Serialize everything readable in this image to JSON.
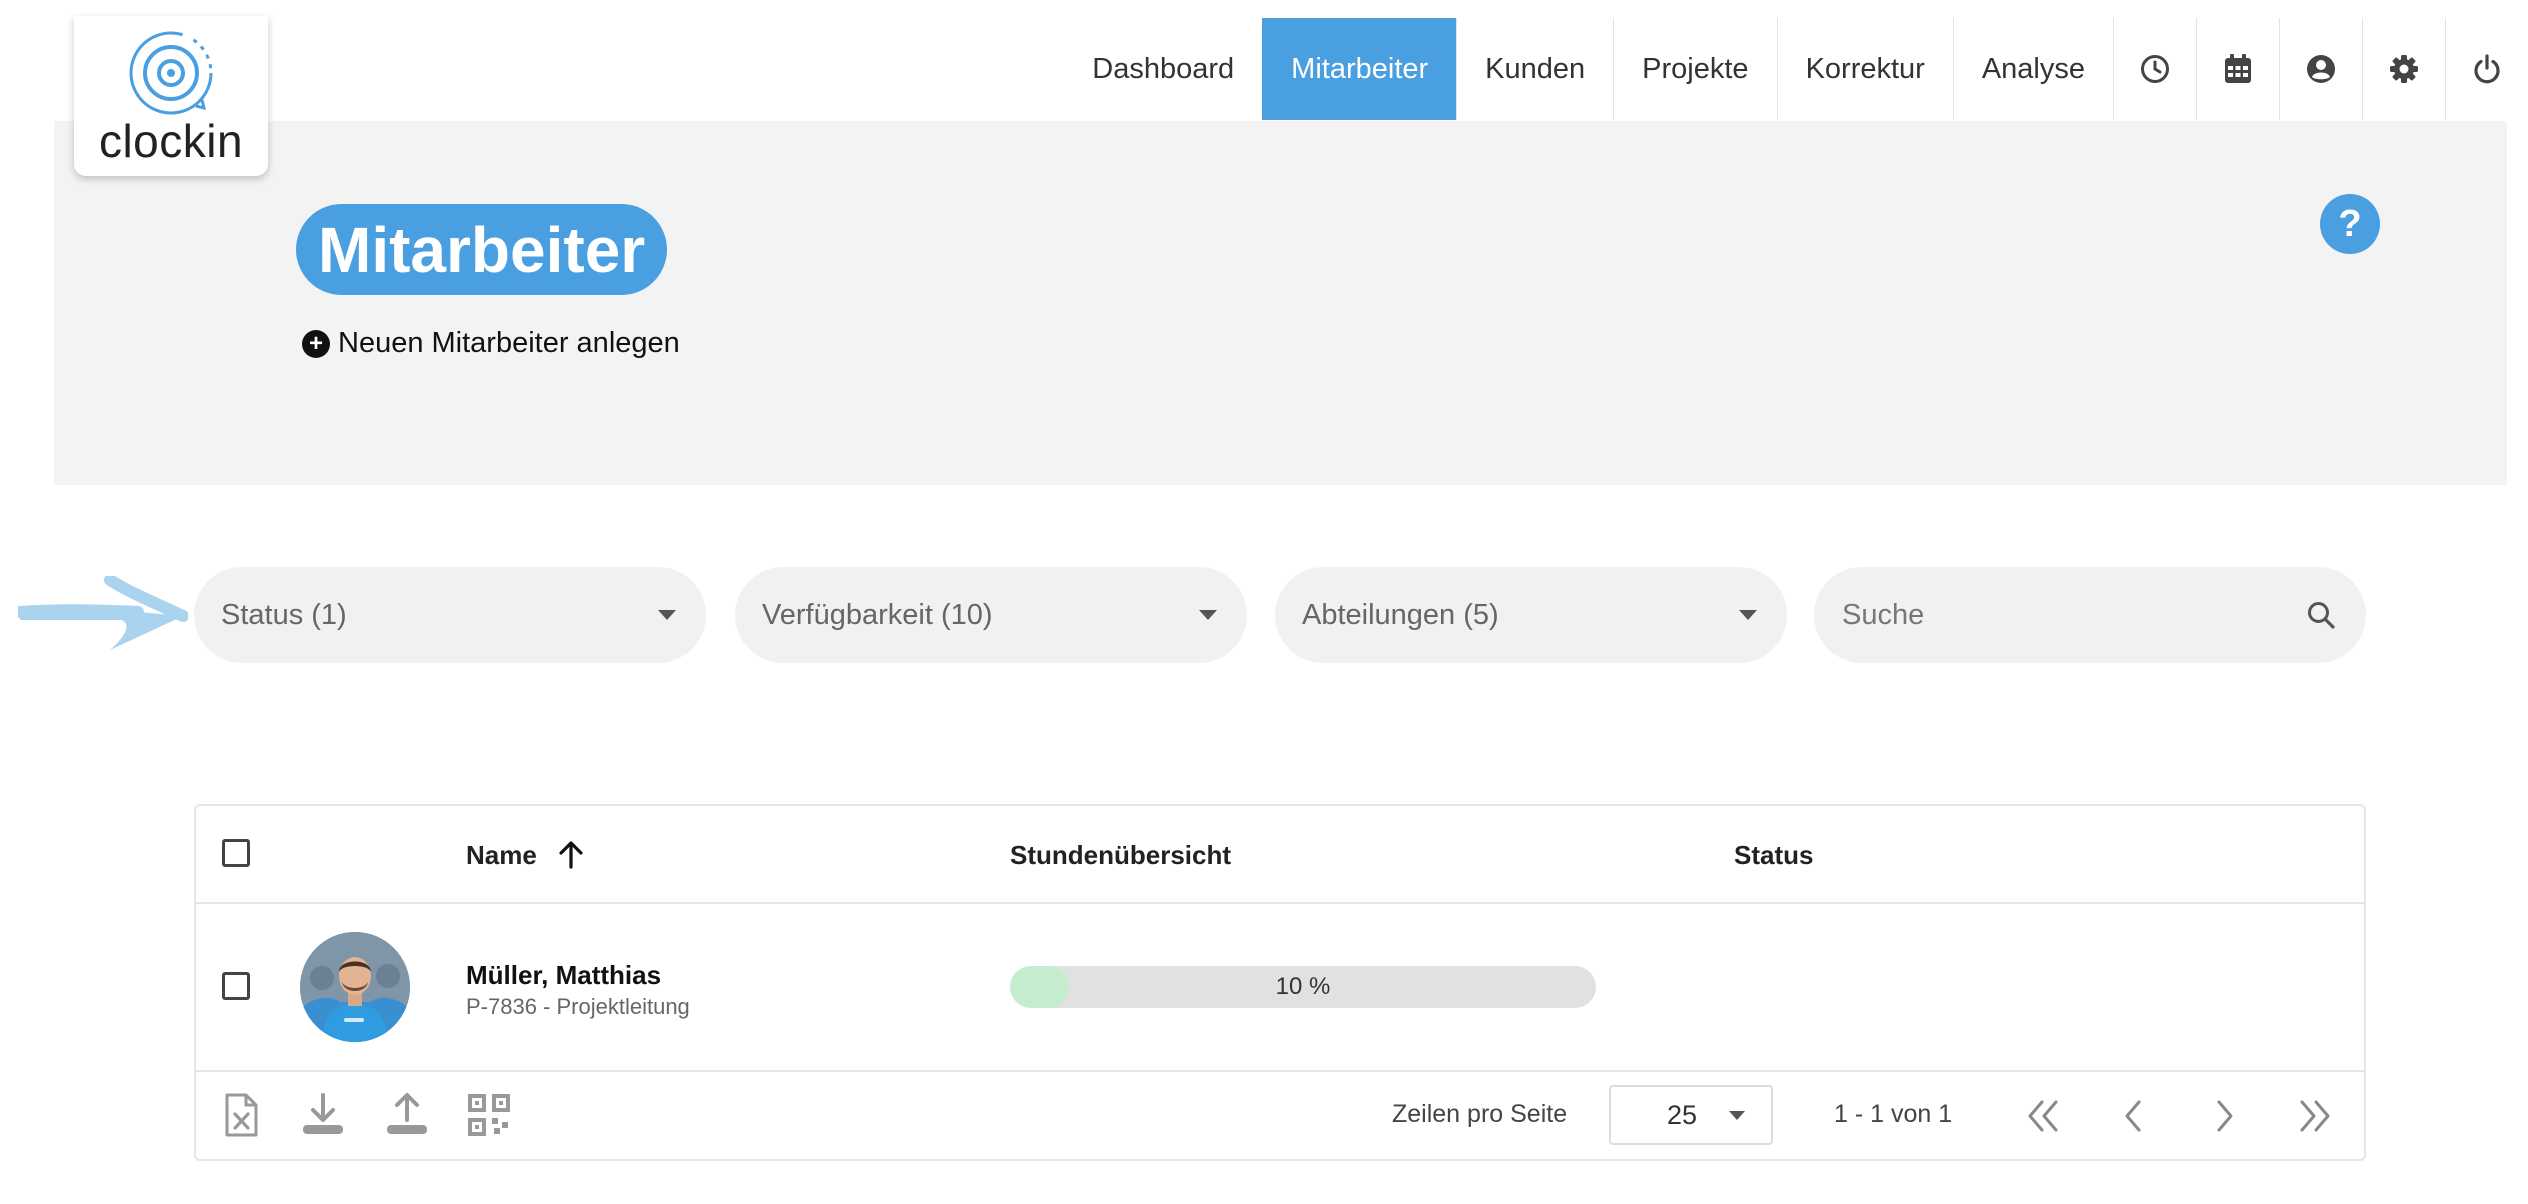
{
  "brand": {
    "name": "clockin"
  },
  "nav": {
    "items": [
      {
        "label": "Dashboard",
        "active": false
      },
      {
        "label": "Mitarbeiter",
        "active": true
      },
      {
        "label": "Kunden",
        "active": false
      },
      {
        "label": "Projekte",
        "active": false
      },
      {
        "label": "Korrektur",
        "active": false
      },
      {
        "label": "Analyse",
        "active": false
      }
    ],
    "icons": [
      "clock-icon",
      "calendar-icon",
      "user-circle-icon",
      "gear-icon",
      "power-icon"
    ]
  },
  "page": {
    "title": "Mitarbeiter",
    "add_label": "Neuen Mitarbeiter anlegen",
    "help_symbol": "?"
  },
  "filters": {
    "status": "Status (1)",
    "availability": "Verfügbarkeit (10)",
    "departments": "Abteilungen (5)",
    "search_placeholder": "Suche"
  },
  "table": {
    "columns": {
      "name": "Name",
      "hours": "Stundenübersicht",
      "status": "Status"
    },
    "rows": [
      {
        "name": "Müller, Matthias",
        "sub": "P-7836 - Projektleitung",
        "progress": 10,
        "progress_label": "10 %",
        "status": ""
      }
    ],
    "footer": {
      "rows_per_page_label": "Zeilen pro Seite",
      "rows_per_page": "25",
      "range": "1 - 1 von 1"
    }
  },
  "colors": {
    "accent": "#4a9fe0",
    "progress": "#c4ecce",
    "arrow": "#a9d3ee"
  }
}
